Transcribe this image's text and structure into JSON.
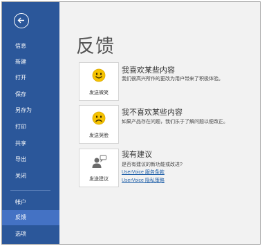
{
  "sidebar": {
    "back_icon": "back-arrow-icon",
    "items": [
      {
        "label": "信息"
      },
      {
        "label": "新建"
      },
      {
        "label": "打开"
      },
      {
        "label": "保存"
      },
      {
        "label": "另存为"
      },
      {
        "label": "打印"
      },
      {
        "label": "共享"
      },
      {
        "label": "导出"
      },
      {
        "label": "关闭"
      },
      {
        "label": "帐户"
      },
      {
        "label": "反馈",
        "active": true
      },
      {
        "label": "选项"
      }
    ]
  },
  "main": {
    "title": "反馈",
    "sections": [
      {
        "title": "我喜欢某些内容",
        "description": "我们很高兴所作的更改为用户带来了积极体验。",
        "card_label": "发送微笑",
        "icon": "smile-icon"
      },
      {
        "title": "我不喜欢某些内容",
        "description": "如果产品存在问题，我们乐于了解问题以便改正。",
        "card_label": "发送哭脸",
        "icon": "frown-icon"
      },
      {
        "title": "我有建议",
        "description": "是否有建议的新功能或改进?",
        "card_label": "发送建议",
        "icon": "suggestion-icon",
        "links": [
          "UserVoice 服务条款",
          "UserVoice 隐私策略"
        ]
      }
    ]
  },
  "colors": {
    "sidebar_bg": "#2b579a",
    "sidebar_active": "#4472c4",
    "smiley_yellow": "#f5c200",
    "link_blue": "#1f5fa8"
  }
}
